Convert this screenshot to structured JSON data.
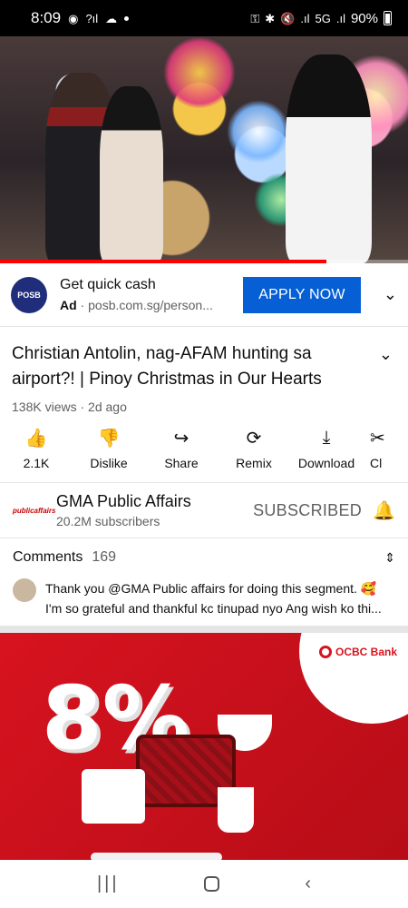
{
  "status_bar": {
    "time": "8:09",
    "network": "5G",
    "battery": "90%"
  },
  "video": {
    "progress_percent": 80
  },
  "ad": {
    "logo_text": "POSB",
    "title": "Get quick cash",
    "ad_label": "Ad",
    "url": "posb.com.sg/person...",
    "cta": "APPLY NOW"
  },
  "video_info": {
    "title": "Christian Antolin, nag-AFAM hunting sa airport?! | Pinoy Christmas in Our Hearts",
    "views": "138K views",
    "age": "2d ago"
  },
  "actions": [
    {
      "label": "2.1K",
      "icon": "like-icon"
    },
    {
      "label": "Dislike",
      "icon": "dislike-icon"
    },
    {
      "label": "Share",
      "icon": "share-icon"
    },
    {
      "label": "Remix",
      "icon": "remix-icon"
    },
    {
      "label": "Download",
      "icon": "download-icon"
    },
    {
      "label": "Cl",
      "icon": "clip-icon"
    }
  ],
  "channel": {
    "logo_text": "publicaffairs",
    "name": "GMA Public Affairs",
    "subscribers": "20.2M subscribers",
    "subscribe_state": "SUBSCRIBED"
  },
  "comments": {
    "label": "Comments",
    "count": "169",
    "top_comment_line1": "Thank you @GMA Public affairs for doing this segment. 🥰",
    "top_comment_line2": "I'm so grateful and thankful kc tinupad nyo Ang wish ko thi..."
  },
  "banner": {
    "brand": "OCBC Bank",
    "headline": "8%"
  },
  "colors": {
    "accent_blue": "#065fd4",
    "youtube_red": "#ff0000",
    "ocbc_red": "#d7131f"
  }
}
